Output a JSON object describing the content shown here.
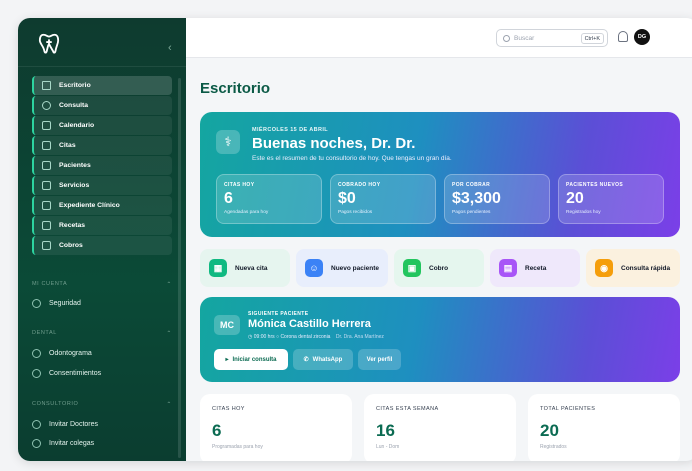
{
  "sidebar": {
    "items": [
      {
        "label": "Escritorio"
      },
      {
        "label": "Consulta"
      },
      {
        "label": "Calendario"
      },
      {
        "label": "Citas"
      },
      {
        "label": "Pacientes"
      },
      {
        "label": "Servicios"
      },
      {
        "label": "Expediente Clínico"
      },
      {
        "label": "Recetas"
      },
      {
        "label": "Cobros"
      }
    ],
    "sections": [
      {
        "title": "MI CUENTA",
        "items": [
          "Seguridad"
        ]
      },
      {
        "title": "DENTAL",
        "items": [
          "Odontograma",
          "Consentimientos"
        ]
      },
      {
        "title": "CONSULTORIO",
        "items": [
          "Invitar Doctores",
          "Invitar colegas"
        ]
      }
    ]
  },
  "topbar": {
    "search_placeholder": "Buscar",
    "shortcut": "Ctrl+K",
    "avatar": "DG"
  },
  "page_title": "Escritorio",
  "hero": {
    "date": "MIÉRCOLES 15 DE ABRIL",
    "greeting": "Buenas noches, Dr. Dr.",
    "subtitle": "Este es el resumen de tu consultorio de hoy. Que tengas un gran día.",
    "stats": [
      {
        "label": "CITAS HOY",
        "value": "6",
        "caption": "Agendadas para hoy"
      },
      {
        "label": "COBRADO HOY",
        "value": "$0",
        "caption": "Pagos recibidos"
      },
      {
        "label": "POR COBRAR",
        "value": "$3,300",
        "caption": "Pagos pendientes"
      },
      {
        "label": "PACIENTES NUEVOS",
        "value": "20",
        "caption": "Registrados hoy"
      }
    ]
  },
  "quick_actions": [
    "Nueva cita",
    "Nuevo paciente",
    "Cobro",
    "Receta",
    "Consulta rápida"
  ],
  "next_patient": {
    "label": "SIGUIENTE PACIENTE",
    "initials": "MC",
    "name": "Mónica Castillo Herrera",
    "time": "09:00 hrs",
    "service": "Corona dental zirconia",
    "doctor": "Dr. Dra. Ana Martínez",
    "buttons": [
      "Iniciar consulta",
      "WhatsApp",
      "Ver perfil"
    ]
  },
  "cards": [
    {
      "label": "CITAS HOY",
      "value": "6",
      "caption": "Programadas para hoy"
    },
    {
      "label": "CITAS ESTA SEMANA",
      "value": "16",
      "caption": "Lun - Dom"
    },
    {
      "label": "TOTAL PACIENTES",
      "value": "20",
      "caption": "Registrados"
    }
  ]
}
